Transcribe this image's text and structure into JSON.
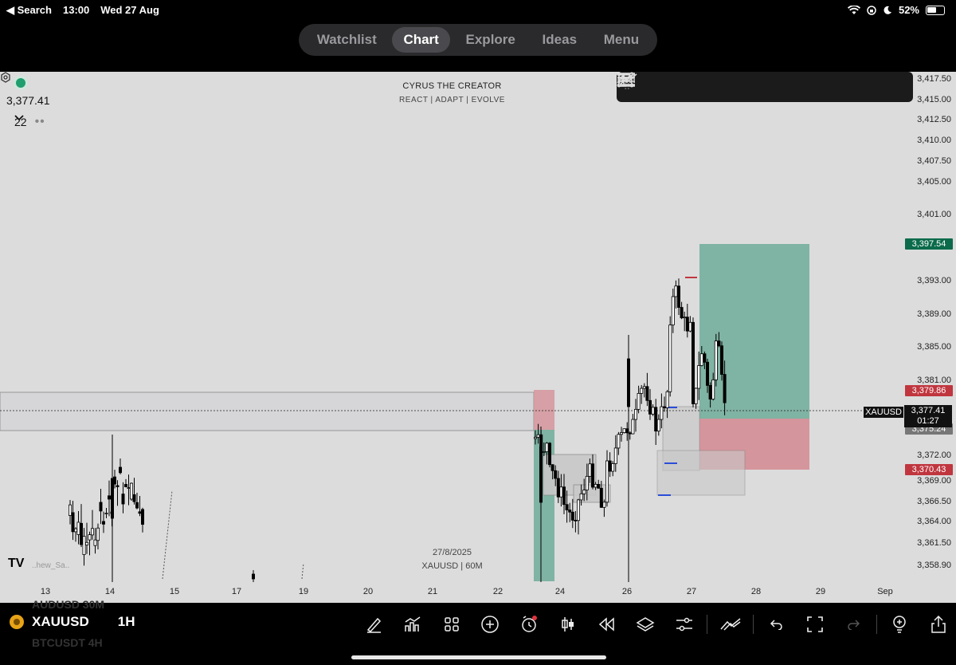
{
  "status_bar": {
    "back_label": "◀ Search",
    "time": "13:00",
    "date": "Wed 27 Aug",
    "battery": "52%"
  },
  "nav": {
    "tabs": [
      "Watchlist",
      "Chart",
      "Explore",
      "Ideas",
      "Menu"
    ],
    "active": "Chart"
  },
  "chart_header": {
    "last_price": "3,377.41",
    "counter": "22",
    "watermark_title": "CYRUS THE CREATOR",
    "watermark_subtitle": "REACT  |  ADAPT  |  EVOLVE"
  },
  "drawing_toolbar": {
    "tools": [
      "horizontal-line-icon",
      "rectangle-icon",
      "parallel-channel-icon",
      "text-icon",
      "fib-retracement-icon",
      "path-icon",
      "trend-line-icon",
      "brush-icon",
      "more-menu-icon"
    ]
  },
  "price_axis": {
    "labels": [
      "3,417.50",
      "3,415.00",
      "3,412.50",
      "3,410.00",
      "3,407.50",
      "3,405.00",
      "3,401.00",
      "3,393.00",
      "3,389.00",
      "3,385.00",
      "3,381.00",
      "3,372.00",
      "3,369.00",
      "3,366.50",
      "3,364.00",
      "3,361.50",
      "3,358.90"
    ],
    "tags": [
      {
        "label": "3,397.54",
        "color": "#0b6b4b"
      },
      {
        "label": "3,379.86",
        "color": "#c0363f"
      },
      {
        "label": "3,375.24",
        "color": "#777777"
      },
      {
        "label": "3,370.43",
        "color": "#c0363f"
      }
    ],
    "current": {
      "symbol": "XAUUSD",
      "price": "3,377.41",
      "countdown": "01:27"
    }
  },
  "time_axis": {
    "labels": [
      "13",
      "14",
      "15",
      "17",
      "19",
      "20",
      "21",
      "22",
      "24",
      "26",
      "27",
      "28",
      "29",
      "Sep"
    ]
  },
  "chart_watermark": {
    "date": "27/8/2025",
    "symbol_tf": "XAUUSD | 60M",
    "author": "..hew_Sa..",
    "logo": "TV"
  },
  "bottom_bar": {
    "symbol": "XAUUSD",
    "timeframe": "1H",
    "ghost_rows": [
      "AUDUSD 30M",
      "BTCUSDT 4H"
    ],
    "tools": [
      "pencil-icon",
      "indicators-icon",
      "layout-grid-icon",
      "add-icon",
      "alert-icon",
      "candle-type-icon",
      "replay-icon",
      "layers-icon",
      "settings-sliders-icon",
      "drawings-icon",
      "undo-icon",
      "fullscreen-icon",
      "redo-icon",
      "ideas-bulb-icon",
      "share-icon"
    ]
  },
  "colors": {
    "long_zone": "#7fb3a3",
    "short_zone": "#d5959c",
    "chart_bg": "#dcdcdc",
    "up_candle": "#ffffff",
    "down_candle": "#000000"
  }
}
